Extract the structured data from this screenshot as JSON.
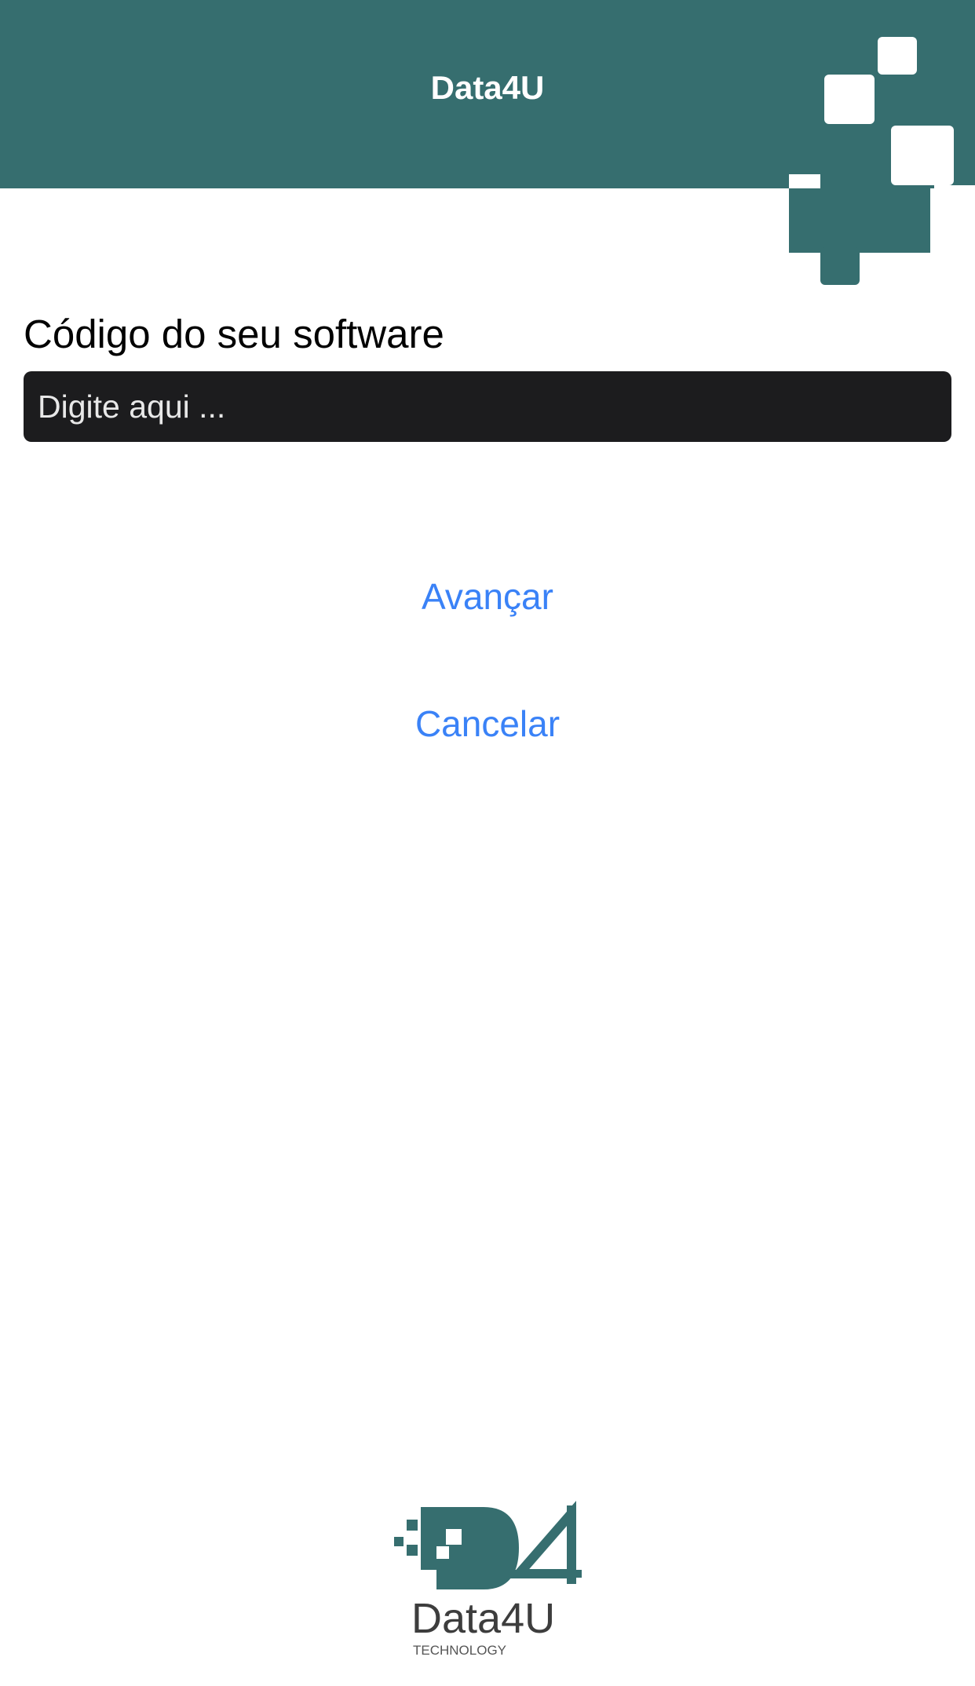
{
  "app": {
    "title": "Data4U"
  },
  "form": {
    "label": "Código do seu software",
    "input_value": "",
    "input_placeholder": "Digite aqui ..."
  },
  "actions": {
    "advance_label": "Avançar",
    "cancel_label": "Cancelar"
  },
  "logo": {
    "name": "Data4U",
    "tagline": "TECHNOLOGY",
    "icon": "d4u-logo-icon"
  },
  "colors": {
    "brand_teal": "#366e6f",
    "input_background": "#1c1c1e",
    "link_blue": "#3a82f7"
  }
}
